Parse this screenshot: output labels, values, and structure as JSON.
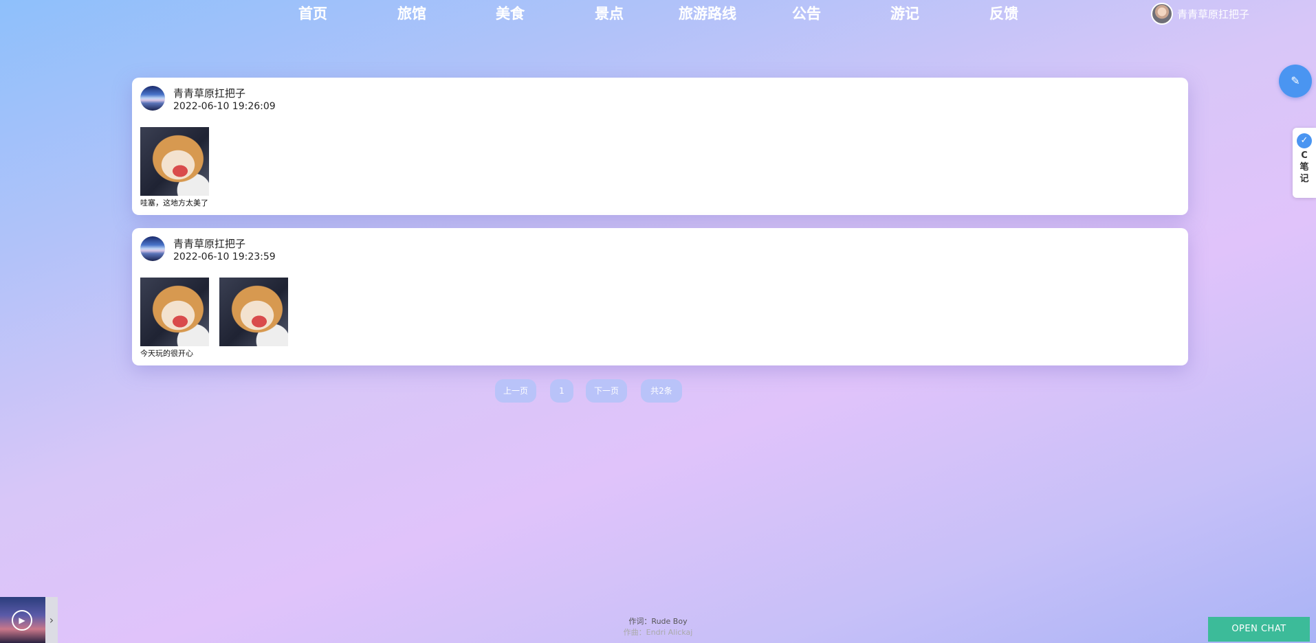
{
  "nav": {
    "items": [
      "首页",
      "旅馆",
      "美食",
      "景点",
      "旅游路线",
      "公告",
      "游记",
      "反馈"
    ],
    "user_name": "青青草原扛把子"
  },
  "posts": [
    {
      "author": "青青草原扛把子",
      "time": "2022-06-10 19:26:09",
      "photos": [
        "corgi-photo"
      ],
      "text": "哇塞，这地方太美了"
    },
    {
      "author": "青青草原扛把子",
      "time": "2022-06-10 19:23:59",
      "photos": [
        "corgi-photo",
        "corgi-photo"
      ],
      "text": "今天玩的很开心"
    }
  ],
  "pager": {
    "prev": "上一页",
    "page": "1",
    "next": "下一页",
    "total": "共2条"
  },
  "floating": {
    "edit_icon": "pen-icon",
    "note_icon": "note-icon",
    "note_label": "C笔记"
  },
  "music": {
    "lyric_line1": "作词：Rude Boy",
    "lyric_line2": "作曲：Endri Alickaj",
    "play_icon": "play-icon"
  },
  "chat": {
    "label": "OPEN CHAT"
  },
  "colors": {
    "accent_blue": "#4a95f1",
    "chat_green": "#3cbb99",
    "pager_bg": "#b9c3f9"
  }
}
